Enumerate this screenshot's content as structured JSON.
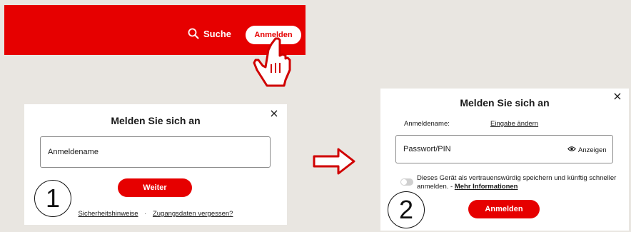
{
  "header": {
    "search_label": "Suche",
    "login_button": "Anmelden",
    "background_color": "#e60000"
  },
  "step1": {
    "number": "1",
    "title": "Melden Sie sich an",
    "close": "×",
    "username_placeholder": "Anmeldename",
    "continue_button": "Weiter",
    "links": {
      "security": "Sicherheitshinweise",
      "separator": "·",
      "forgot": "Zugangsdaten vergessen?"
    }
  },
  "step2": {
    "number": "2",
    "title": "Melden Sie sich an",
    "close": "×",
    "username_label": "Anmeldename:",
    "change_input_link": "Eingabe ändern",
    "password_placeholder": "Passwort/PIN",
    "show_label": "Anzeigen",
    "trust_device_text": "Dieses Gerät als vertrauenswürdig speichern und künftig schneller anmelden. -",
    "more_info_link": "Mehr Informationen",
    "login_button": "Anmelden"
  },
  "icons": {
    "search": "search-icon",
    "close": "close-icon",
    "eye": "eye-icon",
    "cursor": "hand-cursor-icon",
    "arrow": "arrow-right-icon"
  },
  "colors": {
    "accent": "#e60000",
    "background": "#e9e6e1",
    "panel": "#ffffff"
  }
}
